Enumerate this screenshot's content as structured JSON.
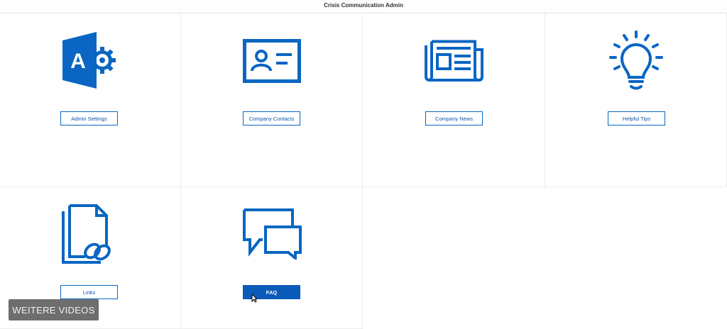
{
  "app": {
    "title": "Crisis Communication Admin"
  },
  "tiles": [
    {
      "label": "Admin Settings",
      "icon": "admin-settings-icon"
    },
    {
      "label": "Company Contacts",
      "icon": "contact-card-icon"
    },
    {
      "label": "Company News",
      "icon": "newspaper-icon"
    },
    {
      "label": "Helpful Tips",
      "icon": "lightbulb-icon"
    },
    {
      "label": "Links",
      "icon": "document-link-icon"
    },
    {
      "label": "FAQ",
      "icon": "chat-bubbles-icon"
    }
  ],
  "overlay": {
    "label": "WEITERE VIDEOS"
  },
  "colors": {
    "accent": "#0a66c2",
    "active_button": "#0a5cb8"
  }
}
